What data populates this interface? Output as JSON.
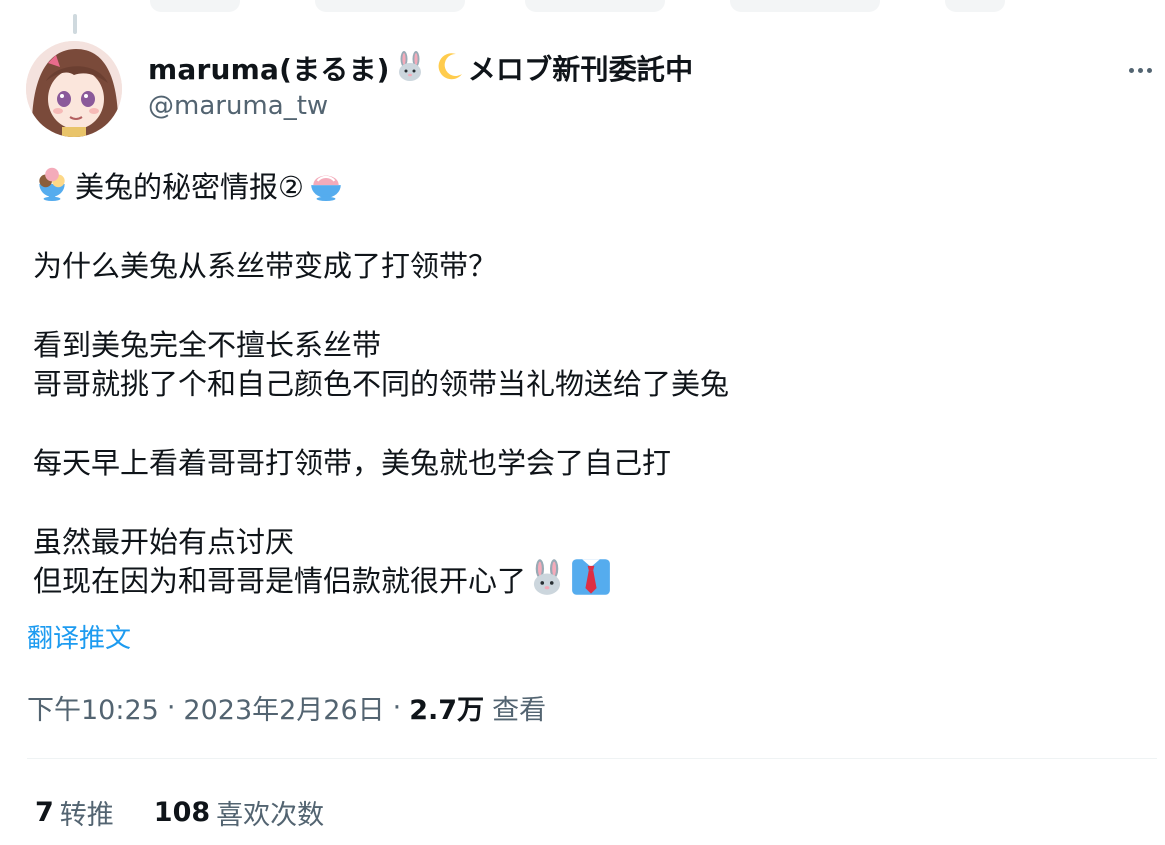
{
  "author": {
    "display_name": "maruma(まるま)",
    "display_name_suffix": "メロブ新刊委託中",
    "handle": "@maruma_tw"
  },
  "icons": {
    "more": "more-horizontal-icon",
    "name_emojis": [
      "rabbit-face-icon",
      "crescent-moon-icon"
    ],
    "line1_emojis": [
      "ice-cream-icon",
      "shaved-ice-icon"
    ],
    "last_line_emojis": [
      "rabbit-face-icon",
      "necktie-icon"
    ]
  },
  "tweet": {
    "lines": [
      "美兔的秘密情报②",
      "为什么美兔从系丝带变成了打领带？",
      "看到美兔完全不擅长系丝带",
      "哥哥就挑了个和自己颜色不同的领带当礼物送给了美兔",
      "每天早上看着哥哥打领带，美兔就也学会了自己打",
      "虽然最开始有点讨厌",
      "但现在因为和哥哥是情侣款就很开心了"
    ],
    "translate_label": "翻译推文"
  },
  "meta": {
    "time": "下午10:25",
    "date": "2023年2月26日",
    "views_count": "2.7万",
    "views_label": "查看",
    "separator": "·"
  },
  "stats": {
    "retweets_count": "7",
    "retweets_label": "转推",
    "likes_count": "108",
    "likes_label": "喜欢次数"
  },
  "colors": {
    "link": "#1d9bf0",
    "secondary_text": "#536471",
    "primary_text": "#0f1419",
    "divider": "#eff3f4"
  }
}
